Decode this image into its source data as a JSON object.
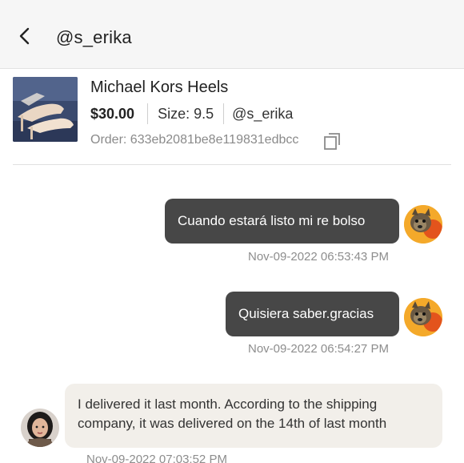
{
  "header": {
    "title": "@s_erika",
    "back_icon": "chevron-left-icon"
  },
  "product": {
    "title": "Michael Kors Heels",
    "price": "$30.00",
    "size": "Size: 9.5",
    "seller": "@s_erika",
    "order": "Order: 633eb2081be8e119831edbcc",
    "copy_icon": "copy-icon"
  },
  "messages": [
    {
      "direction": "outgoing",
      "text": "Cuando estará listo mi re bolso",
      "time": "Nov-09-2022 06:53:43 PM"
    },
    {
      "direction": "outgoing",
      "text": "Quisiera saber.gracias",
      "time": "Nov-09-2022 06:54:27 PM"
    },
    {
      "direction": "incoming",
      "text": "I delivered it last month. According to the shipping company, it was delivered on the 14th of last month",
      "time": "Nov-09-2022 07:03:52 PM"
    }
  ],
  "colors": {
    "header_bg": "#f6f6f6",
    "outgoing_bubble": "#474747",
    "incoming_bubble": "#f2efea",
    "timestamp": "#8d8d8d"
  }
}
